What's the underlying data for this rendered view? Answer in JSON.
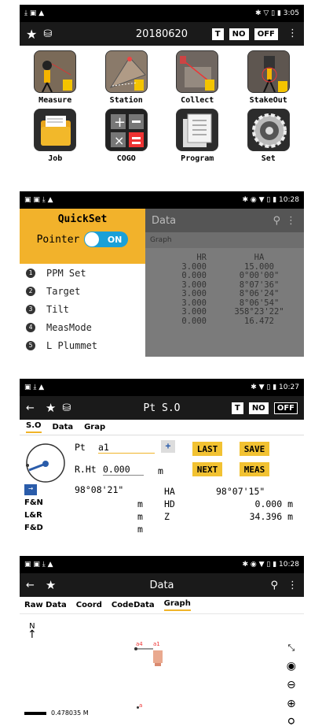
{
  "s1": {
    "status_left": "⤓ ▣ ▲",
    "status_right": "✱ ▽ ▯ ▮ 3:05",
    "title": "20180620",
    "flags": [
      "T",
      "NO",
      "OFF"
    ],
    "tiles": [
      "Measure",
      "Station",
      "Collect",
      "StakeOut",
      "Job",
      "COGO",
      "Program",
      "Set"
    ]
  },
  "s2": {
    "status_right": "✱ ◉ ▼ ▯ ▮ 10:28",
    "bar_title": "Data",
    "tab": "Graph",
    "drawer_title": "QuickSet",
    "pointer_label": "Pointer",
    "toggle": "ON",
    "items": [
      {
        "num": "1",
        "label": "PPM Set"
      },
      {
        "num": "2",
        "label": "Target"
      },
      {
        "num": "3",
        "label": "Tilt"
      },
      {
        "num": "4",
        "label": "MeasMode"
      },
      {
        "num": "5",
        "label": "L Plummet"
      }
    ],
    "table_headers": [
      "HR",
      "HA"
    ],
    "table_rows": [
      [
        "3.000",
        "15.000"
      ],
      [
        "0.000",
        "0°00'00\""
      ],
      [
        "3.000",
        "8°07'36\""
      ],
      [
        "3.000",
        "8°06'24\""
      ],
      [
        "3.000",
        "8°06'54\""
      ],
      [
        "3.000",
        "358°23'22\""
      ],
      [
        "0.000",
        "16.472"
      ]
    ]
  },
  "s3": {
    "status_right": "✱ ▼ ▯ ▮ 10:27",
    "title": "Pt S.O",
    "flags": [
      "T",
      "NO",
      "OFF"
    ],
    "tabs": [
      "S.O",
      "Data",
      "Grap"
    ],
    "pt_label": "Pt",
    "pt_value": "a1",
    "rht_label": "R.Ht",
    "rht_value": "0.000",
    "rht_unit": "m",
    "buttons": [
      "LAST",
      "SAVE",
      "NEXT",
      "MEAS"
    ],
    "angle_left": "98°08'21\"",
    "ha_label": "HA",
    "ha_value": "98°07'15\"",
    "rows": [
      {
        "label": "F&N",
        "unit": "m",
        "k": "HD",
        "v": "0.000 m"
      },
      {
        "label": "L&R",
        "unit": "m",
        "k": "Z",
        "v": "34.396 m"
      },
      {
        "label": "F&D",
        "unit": "m",
        "k": "",
        "v": ""
      }
    ]
  },
  "s4": {
    "status_right": "✱ ◉ ▼ ▯ ▮ 10:28",
    "title": "Data",
    "tabs": [
      "Raw Data",
      "Coord",
      "CodeData",
      "Graph"
    ],
    "north": "N",
    "pt_a4": "a4",
    "pt_a1": "a1",
    "pt_a": "a",
    "scale": "0.478035 M"
  }
}
